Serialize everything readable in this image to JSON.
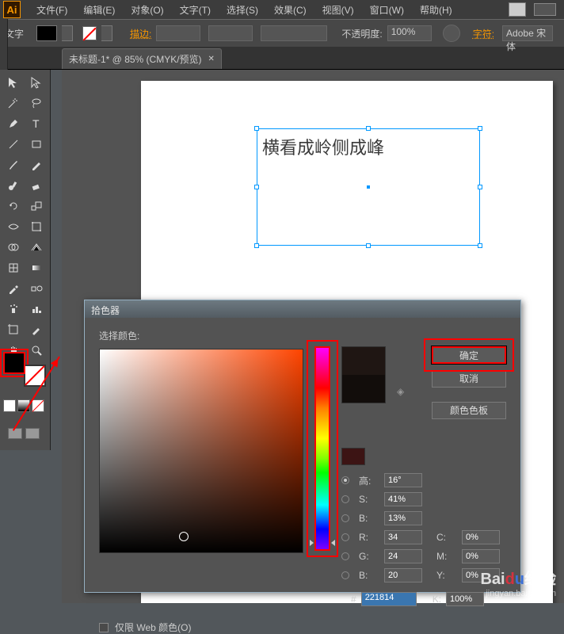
{
  "app": {
    "logo": "Ai"
  },
  "menubar": {
    "items": [
      "文件(F)",
      "编辑(E)",
      "对象(O)",
      "文字(T)",
      "选择(S)",
      "效果(C)",
      "视图(V)",
      "窗口(W)",
      "帮助(H)"
    ]
  },
  "controlbar": {
    "tool_label": "文字",
    "stroke_label": "描边:",
    "opacity_label": "不透明度:",
    "opacity_value": "100%",
    "char_label": "字符:",
    "font_value": "Adobe 宋体"
  },
  "document": {
    "tab_title": "未标题-1* @ 85% (CMYK/预览)",
    "text_content": "横看成岭侧成峰"
  },
  "dialog": {
    "title": "拾色器",
    "select_label": "选择颜色:",
    "ok": "确定",
    "cancel": "取消",
    "swatches": "颜色色板",
    "webonly": "仅限 Web 颜色(O)",
    "H_label": "高:",
    "H_value": "16°",
    "S_label": "S:",
    "S_value": "41%",
    "B_label": "B:",
    "B_value": "13%",
    "R_label": "R:",
    "R_value": "34",
    "G_label": "G:",
    "G_value": "24",
    "Bb_label": "B:",
    "Bb_value": "20",
    "C_label": "C:",
    "C_value": "0%",
    "M_label": "M:",
    "M_value": "0%",
    "Y_label": "Y:",
    "Y_value": "0%",
    "K_label": "K:",
    "K_value": "100%",
    "hex_label": "#",
    "hex_value": "221814"
  },
  "watermark": {
    "brand": "Baidu经验",
    "url": "jingyan.baidu.com"
  }
}
